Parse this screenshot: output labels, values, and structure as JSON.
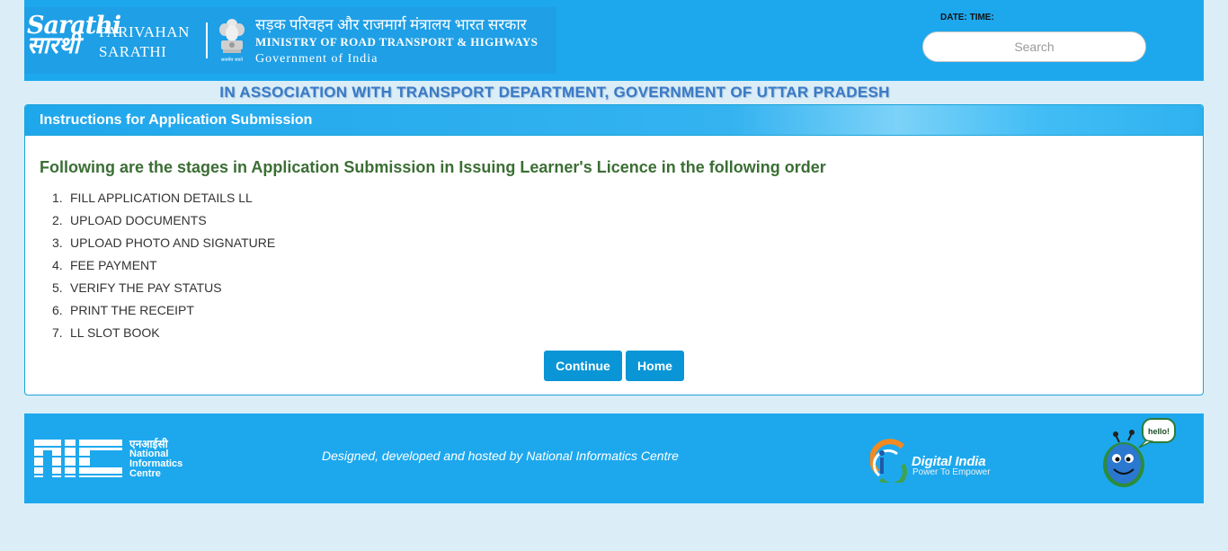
{
  "header": {
    "brand_l1": "Sarathi",
    "brand_l2": "सारथी",
    "parivahan": "PARIVAHAN",
    "sarathi": "SARATHI",
    "ministry_hi": "सड़क परिवहन और राजमार्ग मंत्रालय भारत सरकार",
    "ministry_en": "MINISTRY OF ROAD TRANSPORT & HIGHWAYS",
    "government": "Government of India",
    "emblem_motto": "सत्यमेव जयते",
    "datetime_label": "DATE: TIME:",
    "search_placeholder": "Search"
  },
  "association": "IN ASSOCIATION WITH TRANSPORT DEPARTMENT, GOVERNMENT OF UTTAR PRADESH",
  "panel": {
    "title": "Instructions for Application Submission",
    "heading": "Following are the stages in Application Submission in Issuing Learner's Licence in the following order",
    "steps": [
      {
        "n": "1.",
        "label": "FILL APPLICATION DETAILS LL"
      },
      {
        "n": "2.",
        "label": "UPLOAD DOCUMENTS"
      },
      {
        "n": "3.",
        "label": "UPLOAD PHOTO AND SIGNATURE"
      },
      {
        "n": "4.",
        "label": "FEE PAYMENT"
      },
      {
        "n": "5.",
        "label": "VERIFY THE PAY STATUS"
      },
      {
        "n": "6.",
        "label": "PRINT THE RECEIPT"
      },
      {
        "n": "7.",
        "label": "LL SLOT BOOK"
      }
    ],
    "continue_label": "Continue",
    "home_label": "Home"
  },
  "footer": {
    "nic_hi": "एनआईसी",
    "nic_l1": "National",
    "nic_l2": "Informatics",
    "nic_l3": "Centre",
    "credits": "Designed, developed and hosted by National Informatics Centre",
    "digital_india": "Digital India",
    "digital_india_tagline": "Power To Empower",
    "mascot_text": "hello!"
  },
  "colors": {
    "header_bg": "#1da8ee",
    "page_bg": "#dbeef8",
    "button_bg": "#0a95d6",
    "heading_green": "#3b6e34",
    "association_blue": "#3a7ac6"
  },
  "icons": [
    "national-emblem-icon",
    "nic-logo-icon",
    "digital-india-icon",
    "mascot-icon"
  ]
}
